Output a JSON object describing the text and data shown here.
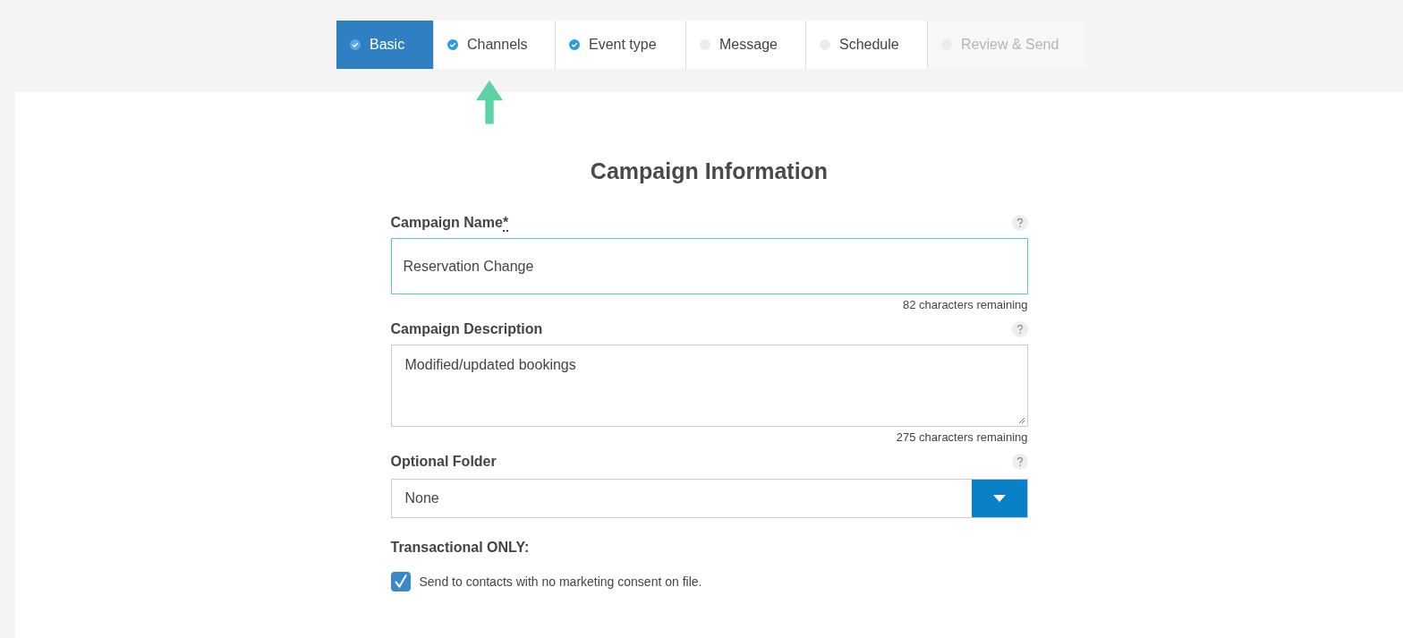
{
  "steps": [
    {
      "label": "Basic",
      "selected": true,
      "done": true,
      "disabled": false
    },
    {
      "label": "Channels",
      "selected": false,
      "done": true,
      "disabled": false
    },
    {
      "label": "Event type",
      "selected": false,
      "done": true,
      "disabled": false
    },
    {
      "label": "Message",
      "selected": false,
      "done": false,
      "disabled": false
    },
    {
      "label": "Schedule",
      "selected": false,
      "done": false,
      "disabled": false
    },
    {
      "label": "Review & Send",
      "selected": false,
      "done": false,
      "disabled": true
    }
  ],
  "heading": "Campaign Information",
  "fields": [
    {
      "kind": "input",
      "label": "Campaign Name",
      "required_mark": "*",
      "value": "Reservation Change",
      "focused": true,
      "counter": "82 characters remaining"
    },
    {
      "kind": "textarea",
      "label": "Campaign Description",
      "value": "Modified/updated bookings",
      "focused": false,
      "counter": "275 characters remaining"
    },
    {
      "kind": "select",
      "label": "Optional Folder",
      "value": "None",
      "focused": false
    }
  ],
  "transactional": {
    "label": "Transactional ONLY:",
    "checkbox_label": "Send to contacts with no marketing consent on file.",
    "checked": true
  }
}
